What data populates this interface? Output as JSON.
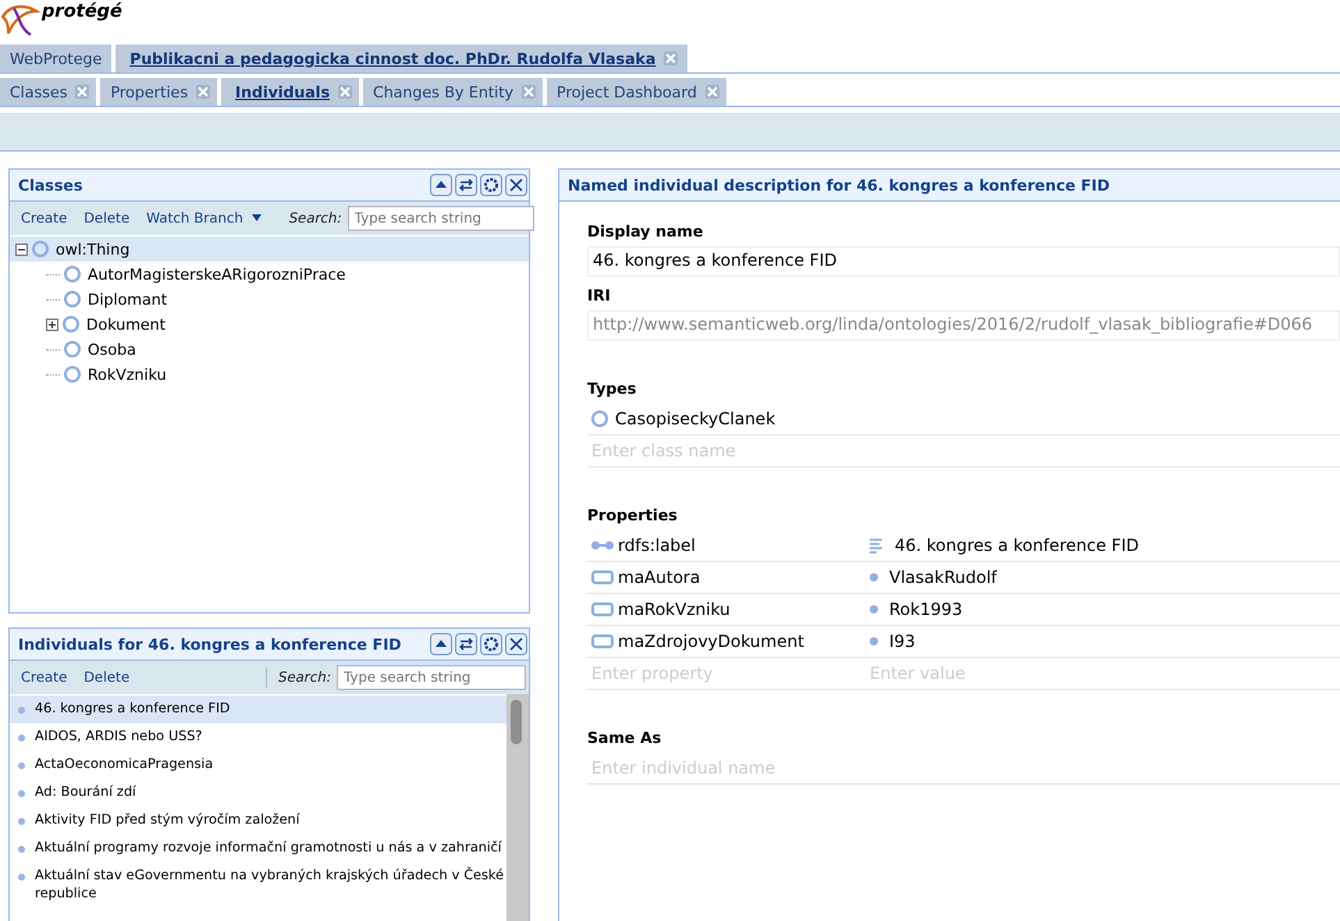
{
  "logo": {
    "text": "protégé"
  },
  "project_tabs": [
    {
      "label": "WebProtege",
      "selected": false,
      "closable": false
    },
    {
      "label": "Publikacni a pedagogicka cinnost doc. PhDr. Rudolfa Vlasaka",
      "selected": true,
      "closable": true
    }
  ],
  "tabs": [
    {
      "label": "Classes",
      "selected": false
    },
    {
      "label": "Properties",
      "selected": false
    },
    {
      "label": "Individuals",
      "selected": true
    },
    {
      "label": "Changes By Entity",
      "selected": false
    },
    {
      "label": "Project Dashboard",
      "selected": false
    }
  ],
  "classes_panel": {
    "title": "Classes",
    "toolbar": [
      {
        "label": "Create",
        "kind": "action"
      },
      {
        "label": "Delete",
        "kind": "action"
      },
      {
        "label": "Watch Branch",
        "kind": "menu"
      }
    ],
    "search_label": "Search:",
    "search_placeholder": "Type search string",
    "tree": [
      {
        "label": "owl:Thing",
        "selected": true,
        "kind": "branch",
        "expanded": true,
        "children": [
          {
            "label": "AutorMagisterskeARigorozniPrace",
            "selected": false,
            "kind": "leaf"
          },
          {
            "label": "Diplomant",
            "selected": false,
            "kind": "leaf"
          },
          {
            "label": "Dokument",
            "selected": false,
            "kind": "branch",
            "expanded": false
          },
          {
            "label": "Osoba",
            "selected": false,
            "kind": "leaf"
          },
          {
            "label": "RokVzniku",
            "selected": false,
            "kind": "leaf"
          }
        ]
      }
    ]
  },
  "individuals_panel": {
    "title": "Individuals for 46. kongres a konference FID",
    "toolbar": [
      {
        "label": "Create",
        "kind": "action"
      },
      {
        "label": "Delete",
        "kind": "action"
      }
    ],
    "search_label": "Search:",
    "search_placeholder": "Type search string",
    "items": [
      {
        "label": "46. kongres a konference FID",
        "selected": true
      },
      {
        "label": "AIDOS, ARDIS nebo USS?",
        "selected": false
      },
      {
        "label": "ActaOeconomicaPragensia",
        "selected": false
      },
      {
        "label": "Ad: Bourání zdí",
        "selected": false
      },
      {
        "label": "Aktivity FID před stým výročím založení",
        "selected": false
      },
      {
        "label": "Aktuální programy rozvoje informační gramotnosti u nás a v zahraničí",
        "selected": false
      },
      {
        "label": "Aktuální stav eGovernmentu na vybraných krajských úřadech v České republice",
        "selected": false
      }
    ]
  },
  "description": {
    "title": "Named individual description for 46. kongres a konference FID",
    "display_name": {
      "label": "Display name",
      "value": "46. kongres a konference FID"
    },
    "iri": {
      "label": "IRI",
      "value": "http://www.semanticweb.org/linda/ontologies/2016/2/rudolf_vlasak_bibliografie#D066"
    },
    "types": {
      "label": "Types",
      "items": [
        "CasopiseckyClanek"
      ],
      "placeholder": "Enter class name"
    },
    "properties": {
      "label": "Properties",
      "rows": [
        {
          "kind": "annotation",
          "property": "rdfs:label",
          "value": "46. kongres a konference FID"
        },
        {
          "kind": "object",
          "property": "maAutora",
          "value": "VlasakRudolf"
        },
        {
          "kind": "object",
          "property": "maRokVzniku",
          "value": "Rok1993"
        },
        {
          "kind": "object",
          "property": "maZdrojovyDokument",
          "value": "I93"
        }
      ],
      "property_placeholder": "Enter property",
      "value_placeholder": "Enter value"
    },
    "same_as": {
      "label": "Same As",
      "placeholder": "Enter individual name"
    }
  }
}
